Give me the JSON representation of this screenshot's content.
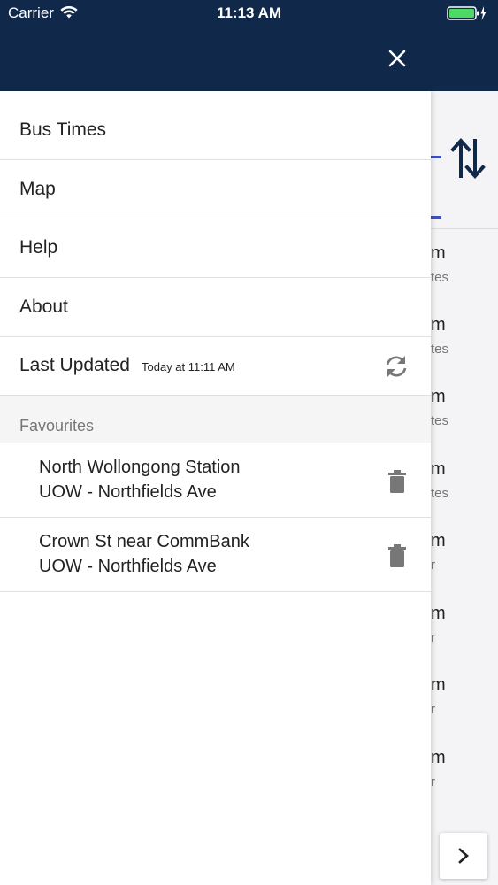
{
  "status_bar": {
    "carrier": "Carrier",
    "time": "11:13 AM",
    "battery_color": "#4cd964"
  },
  "header": {
    "background": "#10294a",
    "close_icon": "close-icon"
  },
  "menu": {
    "items": [
      {
        "label": "Bus Times"
      },
      {
        "label": "Map"
      },
      {
        "label": "Help"
      },
      {
        "label": "About"
      }
    ],
    "last_updated": {
      "label": "Last Updated",
      "value": "Today at 11:11 AM",
      "icon": "refresh-icon"
    }
  },
  "favourites": {
    "header": "Favourites",
    "items": [
      {
        "from": "North Wollongong Station",
        "to": "UOW - Northfields Ave",
        "icon": "trash-icon"
      },
      {
        "from": "Crown St near CommBank",
        "to": "UOW - Northfields Ave",
        "icon": "trash-icon"
      }
    ]
  },
  "background_screen": {
    "rows": [
      {
        "big": "m",
        "small": "tes"
      },
      {
        "big": "m",
        "small": "tes"
      },
      {
        "big": "m",
        "small": "tes"
      },
      {
        "big": "m",
        "small": "tes"
      },
      {
        "big": "m",
        "small": "r"
      },
      {
        "big": "m",
        "small": "r"
      },
      {
        "big": "m",
        "small": "r"
      },
      {
        "big": "m",
        "small": "r"
      }
    ],
    "accent_color": "#3f51b5",
    "swap_icon": "swap-arrows-icon",
    "next_icon": "chevron-right-icon"
  }
}
